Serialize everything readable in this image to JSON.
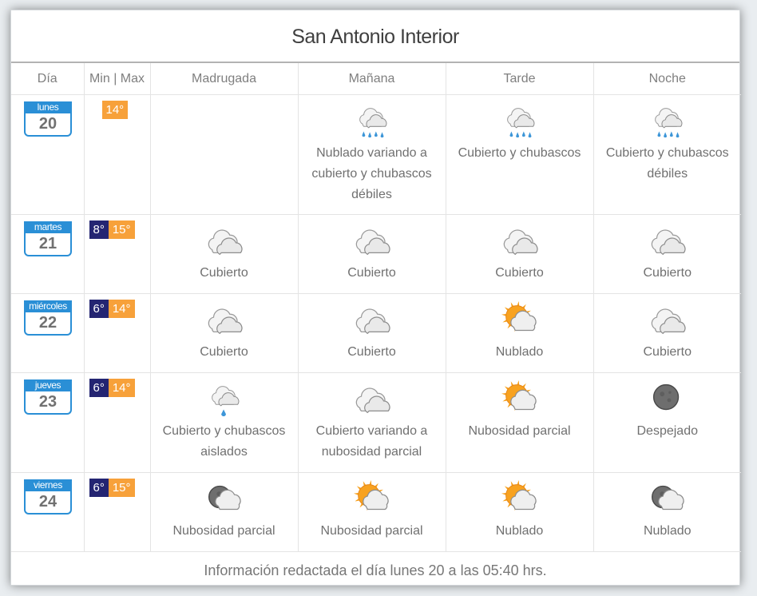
{
  "title": "San Antonio Interior",
  "headers": {
    "dia": "Día",
    "minmax": "Min | Max",
    "madrugada": "Madrugada",
    "manana": "Mañana",
    "tarde": "Tarde",
    "noche": "Noche"
  },
  "days": [
    {
      "day_name": "lunes",
      "day_num": "20",
      "min": null,
      "max": "14°",
      "periods": [
        null,
        {
          "icon": "rain-cloud-icon",
          "text": "Nublado variando a cubierto y chubascos débiles"
        },
        {
          "icon": "rain-cloud-icon",
          "text": "Cubierto y chubascos"
        },
        {
          "icon": "rain-cloud-icon",
          "text": "Cubierto y chubascos débiles"
        }
      ]
    },
    {
      "day_name": "martes",
      "day_num": "21",
      "min": "8°",
      "max": "15°",
      "periods": [
        {
          "icon": "overcast-cloud-icon",
          "text": "Cubierto"
        },
        {
          "icon": "overcast-cloud-icon",
          "text": "Cubierto"
        },
        {
          "icon": "overcast-cloud-icon",
          "text": "Cubierto"
        },
        {
          "icon": "overcast-cloud-icon",
          "text": "Cubierto"
        }
      ]
    },
    {
      "day_name": "miércoles",
      "day_num": "22",
      "min": "6°",
      "max": "14°",
      "periods": [
        {
          "icon": "overcast-cloud-icon",
          "text": "Cubierto"
        },
        {
          "icon": "overcast-cloud-icon",
          "text": "Cubierto"
        },
        {
          "icon": "sun-cloud-icon",
          "text": "Nublado"
        },
        {
          "icon": "overcast-cloud-icon",
          "text": "Cubierto"
        }
      ]
    },
    {
      "day_name": "jueves",
      "day_num": "23",
      "min": "6°",
      "max": "14°",
      "periods": [
        {
          "icon": "light-shower-icon",
          "text": "Cubierto y chubascos aislados"
        },
        {
          "icon": "overcast-cloud-icon",
          "text": "Cubierto variando a nubosidad parcial"
        },
        {
          "icon": "sun-cloud-icon",
          "text": "Nubosidad parcial"
        },
        {
          "icon": "moon-icon",
          "text": "Despejado"
        }
      ]
    },
    {
      "day_name": "viernes",
      "day_num": "24",
      "min": "6°",
      "max": "15°",
      "periods": [
        {
          "icon": "moon-cloud-icon",
          "text": "Nubosidad parcial"
        },
        {
          "icon": "sun-cloud-icon",
          "text": "Nubosidad parcial"
        },
        {
          "icon": "sun-cloud-icon",
          "text": "Nublado"
        },
        {
          "icon": "moon-cloud-icon",
          "text": "Nublado"
        }
      ]
    }
  ],
  "footer": "Información redactada el día lunes 20 a las 05:40 hrs.",
  "colors": {
    "calendar_blue": "#2a8fd6",
    "min_temp": "#242572",
    "max_temp": "#f7a13a",
    "sun": "#f7a01c"
  }
}
